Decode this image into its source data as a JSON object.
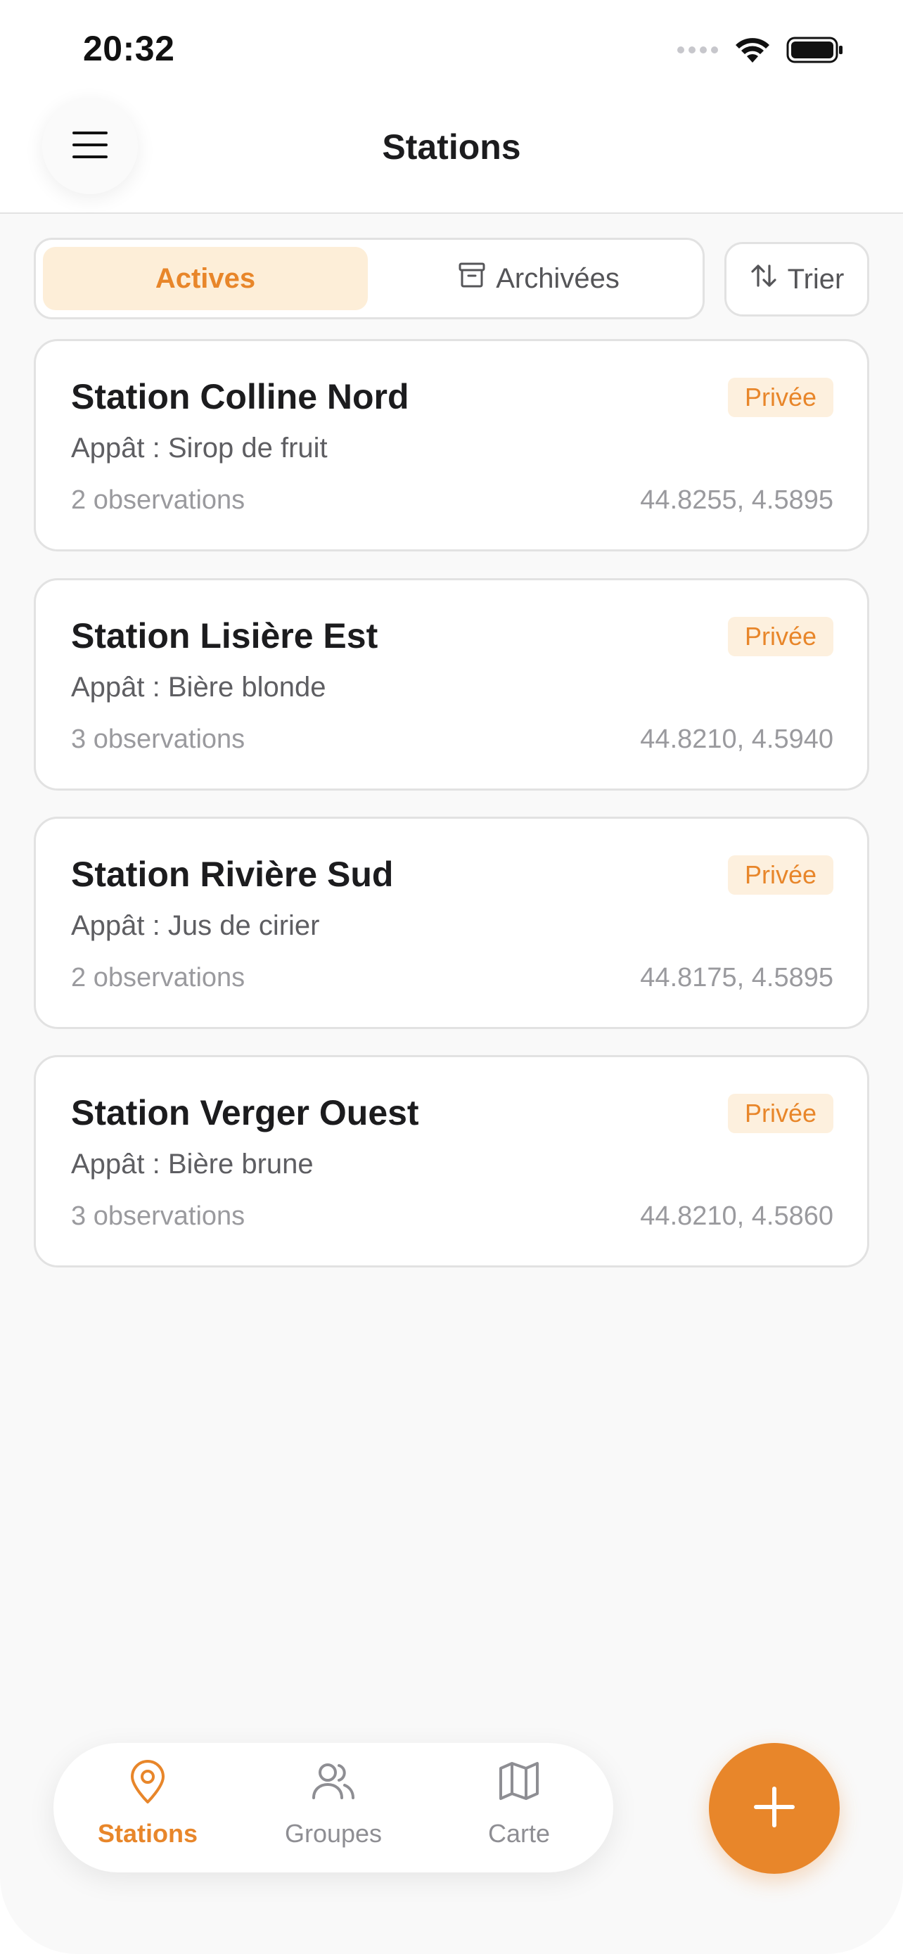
{
  "status_bar": {
    "time": "20:32",
    "icons": [
      "signal-dots-icon",
      "wifi-icon",
      "battery-icon"
    ]
  },
  "header": {
    "title": "Stations",
    "menu_icon": "hamburger-menu-icon"
  },
  "segmented": {
    "active_label": "Actives",
    "archived_label": "Archivées",
    "archived_icon": "archive-box-icon"
  },
  "sort": {
    "label": "Trier",
    "icon": "sort-arrows-icon"
  },
  "stations": [
    {
      "name": "Station Colline Nord",
      "badge": "Privée",
      "bait": "Appât : Sirop de fruit",
      "observations": "2 observations",
      "coords": "44.8255, 4.5895"
    },
    {
      "name": "Station Lisière Est",
      "badge": "Privée",
      "bait": "Appât : Bière blonde",
      "observations": "3 observations",
      "coords": "44.8210, 4.5940"
    },
    {
      "name": "Station Rivière Sud",
      "badge": "Privée",
      "bait": "Appât : Jus de cirier",
      "observations": "2 observations",
      "coords": "44.8175, 4.5895"
    },
    {
      "name": "Station Verger Ouest",
      "badge": "Privée",
      "bait": "Appât : Bière brune",
      "observations": "3 observations",
      "coords": "44.8210, 4.5860"
    }
  ],
  "tab_bar": {
    "tabs": [
      {
        "label": "Stations",
        "icon": "map-pin-icon",
        "active": true
      },
      {
        "label": "Groupes",
        "icon": "users-icon",
        "active": false
      },
      {
        "label": "Carte",
        "icon": "map-icon",
        "active": false
      }
    ]
  },
  "fab": {
    "icon": "plus-icon"
  },
  "colors": {
    "accent": "#e8862a",
    "accent_soft": "#fdeed8",
    "background": "#f9f9f9",
    "card": "#ffffff",
    "border": "#e2e2e2",
    "text_primary": "#1c1c1e",
    "text_secondary": "#5e5e62",
    "text_muted": "#9a9a9e"
  }
}
